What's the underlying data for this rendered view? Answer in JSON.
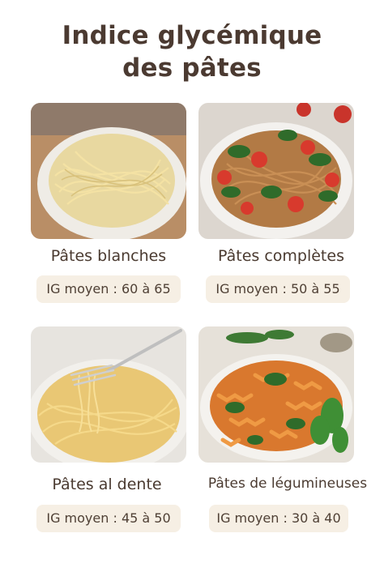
{
  "title": {
    "line1": "Indice glycémique",
    "line2": "des pâtes"
  },
  "cards": [
    {
      "name": "Pâtes blanches",
      "ig": "IG moyen : 60 à 65",
      "image": "white-spaghetti-bowl"
    },
    {
      "name": "Pâtes complètes",
      "ig": "IG moyen : 50 à 55",
      "image": "whole-wheat-spaghetti-spinach-tomatoes"
    },
    {
      "name": "Pâtes al dente",
      "ig": "IG moyen : 45 à 50",
      "image": "al-dente-spaghetti-fork"
    },
    {
      "name": "Pâtes de légumineuses",
      "ig": "IG moyen : 30 à 40",
      "image": "legume-fusilli-spinach-basil"
    }
  ]
}
